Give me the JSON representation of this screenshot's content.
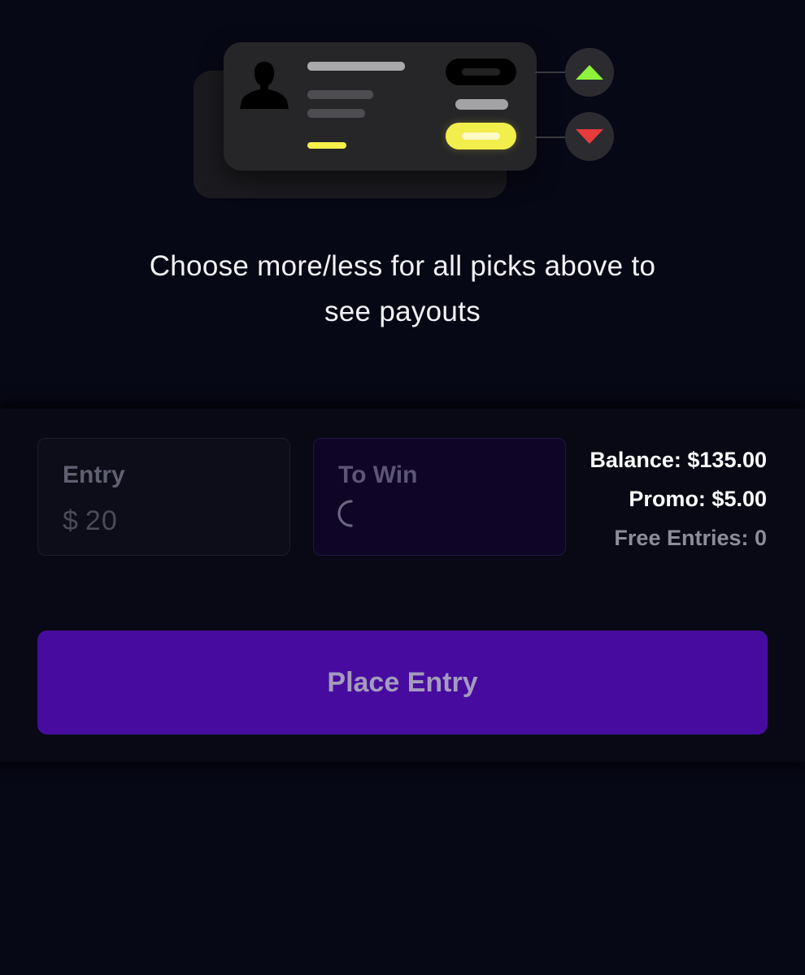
{
  "prompt": {
    "line1": "Choose more/less for all picks above to",
    "line2": "see payouts"
  },
  "entry": {
    "label": "Entry",
    "currency": "$",
    "amount": "20"
  },
  "to_win": {
    "label": "To Win",
    "state": "loading"
  },
  "balances": {
    "balance": "Balance: $135.00",
    "promo": "Promo: $5.00",
    "free_entries": "Free Entries: 0"
  },
  "place_entry": {
    "label": "Place Entry"
  },
  "illustration": {
    "up_icon": "triangle-up-icon",
    "down_icon": "triangle-down-icon",
    "up_color": "#8ef23c",
    "down_color": "#e63c3c",
    "accent_yellow": "#f2ee4b"
  },
  "colors": {
    "background": "#070815",
    "button": "#470c9f",
    "to_win_box": "#0f0526"
  }
}
